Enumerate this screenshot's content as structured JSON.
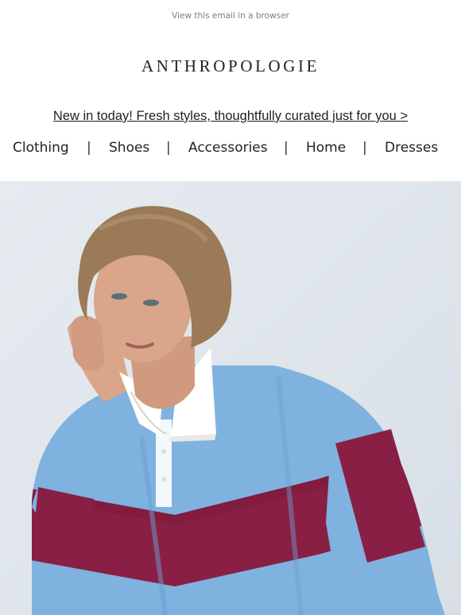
{
  "email": {
    "preheader_link": "View this email in a browser",
    "brand": "ANTHROPOLOGIE",
    "promo_link": "New in today! Fresh styles, thoughtfully curated just for you >"
  },
  "nav": {
    "items": [
      {
        "label": "Clothing"
      },
      {
        "label": "Shoes"
      },
      {
        "label": "Accessories"
      },
      {
        "label": "Home"
      },
      {
        "label": "Dresses"
      }
    ],
    "separator": "|"
  },
  "hero": {
    "image": "woman in striped rugby polo",
    "colors": {
      "background": "#e2e8ee",
      "shirt_blue": "#7fb2df",
      "shirt_stripe": "#8a1f45",
      "collar": "#ffffff",
      "skin": "#d9a68a",
      "hair": "#9a7a57"
    }
  }
}
